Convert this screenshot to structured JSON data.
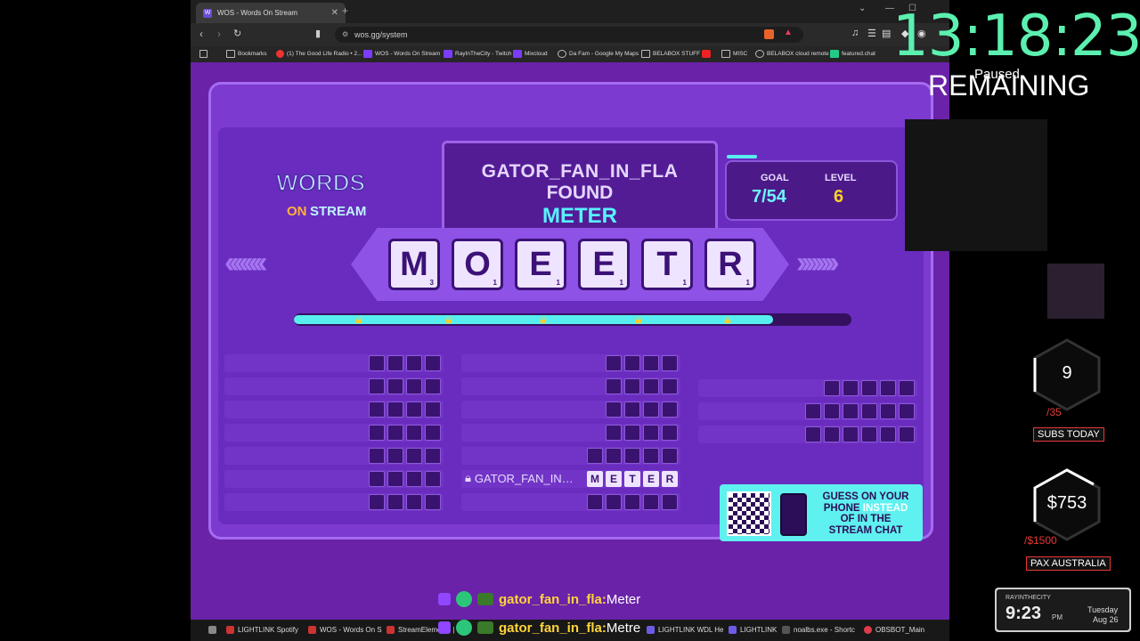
{
  "browser": {
    "tab_title": "WOS - Words On Stream",
    "tab_favicon": "W",
    "url": "wos.gg/system",
    "bookmarks": [
      "Bookmarks",
      "(1) The Good Life Radio • 2...",
      "WOS - Words On Stream",
      "RayInTheCity - Twitch",
      "Mixcloud",
      "Da Fam - Google My Maps",
      "BELABOX STUFF",
      "MISC",
      "BELABOX cloud remote",
      "featured.chat"
    ]
  },
  "game": {
    "logo_line1": "WORDS",
    "logo_on": "ON",
    "logo_line2": "STREAM",
    "found_user": "GATOR_FAN_IN_FLA",
    "found_label": "FOUND",
    "found_word": "METER",
    "goal_label": "GOAL",
    "goal_value": "7/54",
    "level_label": "LEVEL",
    "level_value": "6",
    "tiles": [
      {
        "letter": "M",
        "points": "3"
      },
      {
        "letter": "O",
        "points": "1"
      },
      {
        "letter": "E",
        "points": "1"
      },
      {
        "letter": "E",
        "points": "1"
      },
      {
        "letter": "T",
        "points": "1"
      },
      {
        "letter": "R",
        "points": "1"
      }
    ],
    "progress": 0.86,
    "found_slot_user": "GATOR_FAN_IN…",
    "found_slot_letters": [
      "M",
      "E",
      "T",
      "E",
      "R"
    ],
    "qr_line1": "GUESS ON YOUR",
    "qr_line2_a": "PHONE",
    "qr_line2_b": " INSTEAD",
    "qr_line3": "OF IN THE",
    "qr_line4": "STREAM CHAT"
  },
  "chat": [
    {
      "user": "gator_fan_in_fla:",
      "message": " Meter"
    },
    {
      "user": "gator_fan_in_fla:",
      "message": " Metre"
    }
  ],
  "taskbar": [
    "LIGHTLINK Spotify",
    "WOS - Words On S",
    "StreamElements | T",
    "LIGHTLINK WDL He",
    "LIGHTLINK",
    "noalbs.exe - Shortc",
    "OBSBOT_Main"
  ],
  "overlay": {
    "timer": "13:18:23",
    "paused": "Paused",
    "remaining": "REMAINING",
    "subs_count": "9",
    "subs_goal": "/35",
    "subs_label": "SUBS TODAY",
    "money_count": "$753",
    "money_goal": "/$1500",
    "money_label": "PAX AUSTRALIA",
    "clock_brand": "RAYINTHECITY",
    "clock_time": "9:23",
    "clock_ampm": "PM",
    "clock_day": "Tuesday",
    "clock_date": "Aug 26"
  }
}
